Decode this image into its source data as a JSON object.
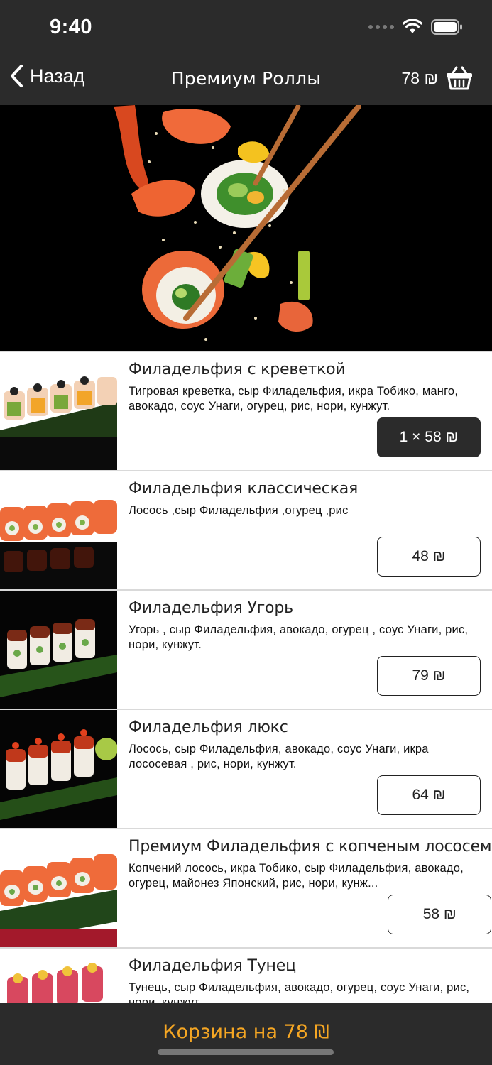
{
  "status_bar": {
    "time": "9:40"
  },
  "nav": {
    "back_label": "Назад",
    "title": "Премиум Роллы",
    "cart_amount": "78 ₪"
  },
  "items": [
    {
      "name": "Филадельфия с креветкой",
      "description": "Тигровая  креветка, сыр Филадельфия, икра Тобико, манго, авокадо, соус Унаги, огурец, рис, нори, кунжут.",
      "price": "1 × 58 ₪",
      "in_cart": true
    },
    {
      "name": "Филадельфия классическая",
      "description": "Лосось ,сыр Филадельфия ,огурец ,рис",
      "price": "48 ₪",
      "in_cart": false
    },
    {
      "name": "Филадельфия Угорь",
      "description": "Угорь , сыр Филадельфия, авокадо, огурец , соус Унаги, рис, нори, кунжут.",
      "price": "79 ₪",
      "in_cart": false
    },
    {
      "name": "Филадельфия люкс",
      "description": "Лосось, сыр Филадельфия, авокадо, соус Унаги, икра лососевая , рис, нори, кунжут.",
      "price": "64 ₪",
      "in_cart": false
    },
    {
      "name": "Премиум Филадельфия с копченым лососем",
      "description": "Копчений лосось, икра Тобико, сыр Филадельфия, авокадо, огурец, майонез Японский, рис, нори, кунж...",
      "price": "58 ₪",
      "in_cart": false
    },
    {
      "name": "Филадельфия Тунец",
      "description": "Тунець, сыр Филадельфия, авокадо, огурец, соус Унаги, рис, нори, кунжут.",
      "price": "",
      "in_cart": false
    }
  ],
  "bottom_bar": {
    "cart_label": "Корзина на 78 ₪"
  },
  "colors": {
    "bar": "#2b2b2b",
    "accent": "#f5a623"
  }
}
